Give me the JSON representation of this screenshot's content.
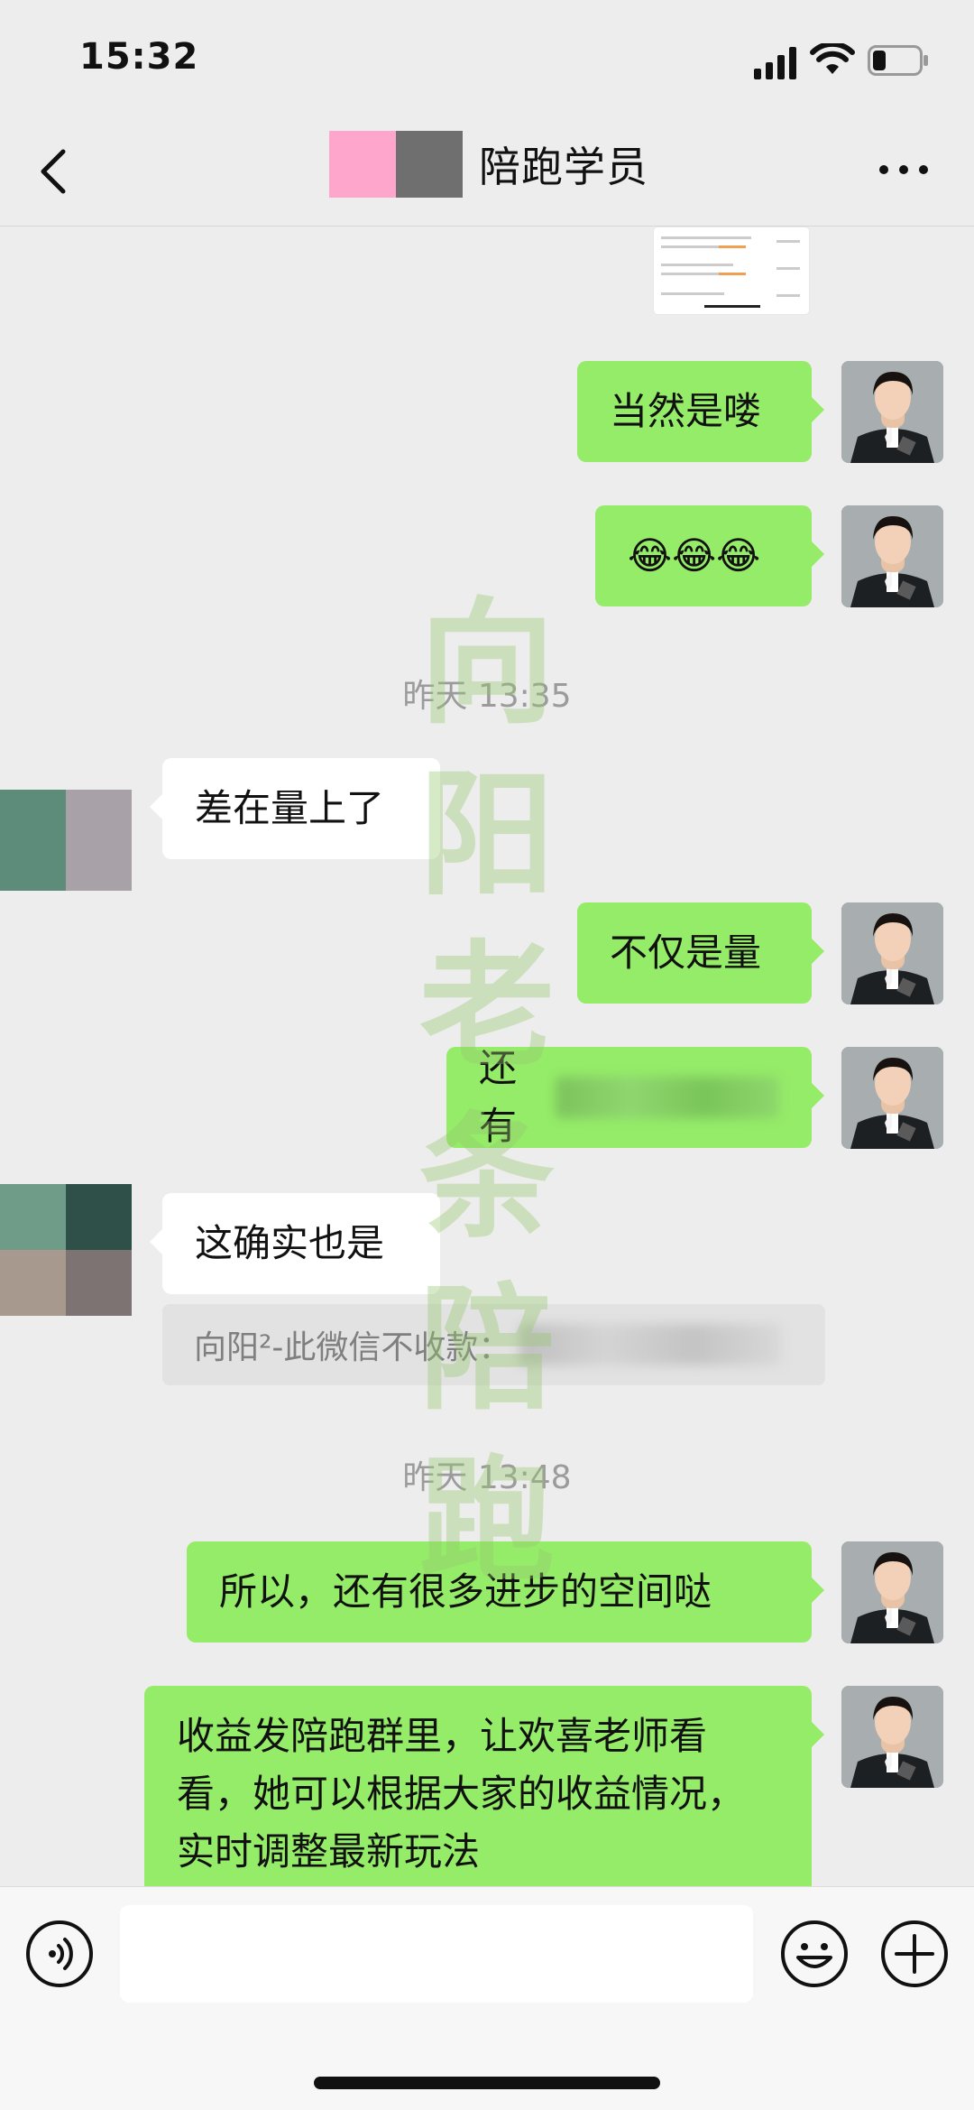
{
  "status": {
    "time": "15:32"
  },
  "nav": {
    "title": "陪跑学员",
    "title_prefix_blocks": [
      "#ffa6cc",
      "#6f6f6f"
    ]
  },
  "messages": [
    {
      "side": "me",
      "text": "当然是喽"
    },
    {
      "side": "me",
      "text": "😂😂😂"
    },
    {
      "type": "time",
      "text": "昨天 13:35"
    },
    {
      "side": "them",
      "text": "差在量上了"
    },
    {
      "side": "me",
      "text": "不仅是量"
    },
    {
      "side": "me",
      "text": "还有"
    },
    {
      "side": "them",
      "text": "这确实也是"
    },
    {
      "type": "quote",
      "text": "向阳²-此微信不收款："
    },
    {
      "type": "time",
      "text": "昨天 13:48"
    },
    {
      "side": "me",
      "text": "所以，还有很多进步的空间哒"
    },
    {
      "side": "me",
      "text": "收益发陪跑群里，让欢喜老师看看，她可以根据大家的收益情况，实时调整最新玩法"
    }
  ],
  "watermark": {
    "chars": [
      "向",
      "阳",
      "老",
      "条",
      "陪",
      "跑"
    ]
  },
  "input": {
    "value": ""
  },
  "colors": {
    "my_bubble": "#95ec69",
    "their_bubble": "#ffffff",
    "background": "#ededed"
  }
}
